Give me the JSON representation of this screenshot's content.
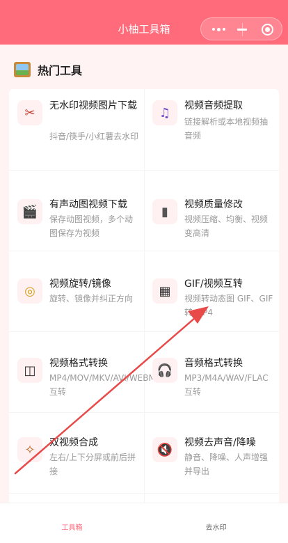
{
  "app": {
    "title": "小柚工具箱"
  },
  "capsule": {
    "more_icon": "more-dots-icon",
    "minimize_icon": "minimize-icon",
    "close_icon": "target-circle-icon"
  },
  "section": {
    "title": "热门工具",
    "icon": "picture-frame-icon"
  },
  "tools": [
    {
      "name": "无水印视频图片下载",
      "desc": "抖音/筷手/小红薯去水印",
      "icon": "scissors-icon",
      "glyph": "✂"
    },
    {
      "name": "视频音频提取",
      "desc": "链接解析或本地视频抽音频",
      "icon": "music-note-icon",
      "glyph": "♫"
    },
    {
      "name": "有声动图视频下载",
      "desc": "保存动图视频，多个动图保存为视频",
      "icon": "clapperboard-icon",
      "glyph": "🎬"
    },
    {
      "name": "视频质量修改",
      "desc": "视频压缩、均衡、视频变高清",
      "icon": "fader-icon",
      "glyph": "▮"
    },
    {
      "name": "视频旋转/镜像",
      "desc": "旋转、镜像并纠正方向",
      "icon": "compass-icon",
      "glyph": "◎"
    },
    {
      "name": "GIF/视频互转",
      "desc": "视频转动态图 GIF、GIF 转 MP4",
      "icon": "film-strip-icon",
      "glyph": "▦"
    },
    {
      "name": "视频格式转换",
      "desc": "MP4/MOV/MKV/AVI/WEBM 互转",
      "icon": "video-format-icon",
      "glyph": "◫"
    },
    {
      "name": "音频格式转换",
      "desc": "MP3/M4A/WAV/FLAC 互转",
      "icon": "headphones-icon",
      "glyph": "🎧"
    },
    {
      "name": "双视频合成",
      "desc": "左右/上下分屏或前后拼接",
      "icon": "film-roll-icon",
      "glyph": "✧"
    },
    {
      "name": "视频去声音/降噪",
      "desc": "静音、降噪、人声增强并导出",
      "icon": "mute-speaker-icon",
      "glyph": "🔇"
    }
  ],
  "tabbar": {
    "tabs": [
      {
        "label": "工具箱",
        "active": true
      },
      {
        "label": "去水印",
        "active": false
      }
    ]
  },
  "colors": {
    "header": "#ff6b7a",
    "active_tab": "#ff6b7a",
    "inactive_tab": "#666666",
    "annotation_arrow": "#e84a4a"
  },
  "annotation": {
    "type": "red-arrow",
    "points_to": "GIF/视频互转"
  }
}
